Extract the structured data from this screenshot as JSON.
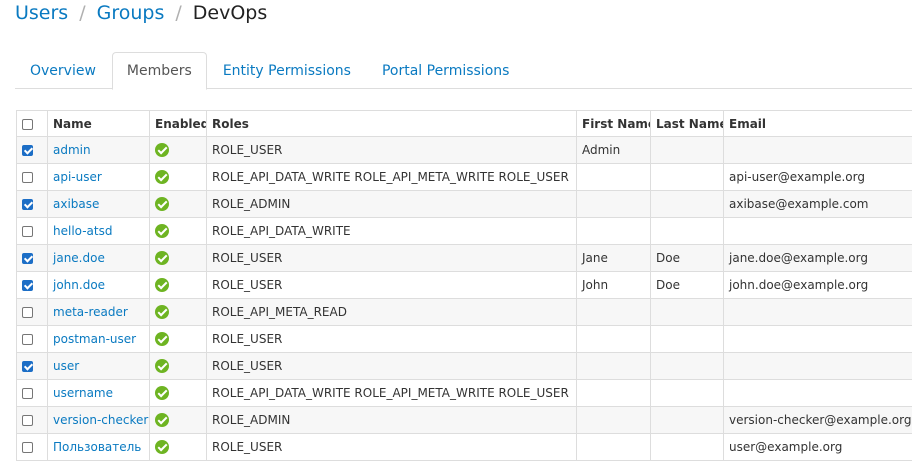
{
  "breadcrumb": {
    "items": [
      "Users",
      "Groups"
    ],
    "separator": "/",
    "current": "DevOps"
  },
  "tabs": [
    "Overview",
    "Members",
    "Entity Permissions",
    "Portal Permissions"
  ],
  "active_tab": "Members",
  "table": {
    "columns": [
      "Name",
      "Enabled",
      "Roles",
      "First Name",
      "Last Name",
      "Email"
    ],
    "rows": [
      {
        "checked": true,
        "name": "admin",
        "enabled": true,
        "roles": "ROLE_USER",
        "first_name": "Admin",
        "last_name": "",
        "email": ""
      },
      {
        "checked": false,
        "name": "api-user",
        "enabled": true,
        "roles": "ROLE_API_DATA_WRITE ROLE_API_META_WRITE ROLE_USER",
        "first_name": "",
        "last_name": "",
        "email": "api-user@example.org"
      },
      {
        "checked": true,
        "name": "axibase",
        "enabled": true,
        "roles": "ROLE_ADMIN",
        "first_name": "",
        "last_name": "",
        "email": "axibase@example.com"
      },
      {
        "checked": false,
        "name": "hello-atsd",
        "enabled": true,
        "roles": "ROLE_API_DATA_WRITE",
        "first_name": "",
        "last_name": "",
        "email": ""
      },
      {
        "checked": true,
        "name": "jane.doe",
        "enabled": true,
        "roles": "ROLE_USER",
        "first_name": "Jane",
        "last_name": "Doe",
        "email": "jane.doe@example.org"
      },
      {
        "checked": true,
        "name": "john.doe",
        "enabled": true,
        "roles": "ROLE_USER",
        "first_name": "John",
        "last_name": "Doe",
        "email": "john.doe@example.org"
      },
      {
        "checked": false,
        "name": "meta-reader",
        "enabled": true,
        "roles": "ROLE_API_META_READ",
        "first_name": "",
        "last_name": "",
        "email": ""
      },
      {
        "checked": false,
        "name": "postman-user",
        "enabled": true,
        "roles": "ROLE_USER",
        "first_name": "",
        "last_name": "",
        "email": ""
      },
      {
        "checked": true,
        "name": "user",
        "enabled": true,
        "roles": "ROLE_USER",
        "first_name": "",
        "last_name": "",
        "email": ""
      },
      {
        "checked": false,
        "name": "username",
        "enabled": true,
        "roles": "ROLE_API_DATA_WRITE ROLE_API_META_WRITE ROLE_USER",
        "first_name": "",
        "last_name": "",
        "email": ""
      },
      {
        "checked": false,
        "name": "version-checker",
        "enabled": true,
        "roles": "ROLE_ADMIN",
        "first_name": "",
        "last_name": "",
        "email": "version-checker@example.org"
      },
      {
        "checked": false,
        "name": "Пользователь",
        "enabled": true,
        "roles": "ROLE_USER",
        "first_name": "",
        "last_name": "",
        "email": "user@example.org"
      }
    ]
  },
  "colors": {
    "link": "#0a7ac1",
    "enabled_ok": "#6eb422",
    "checkbox_checked": "#1c6ec6"
  },
  "icons": {
    "enabled": "check-circle-icon"
  }
}
